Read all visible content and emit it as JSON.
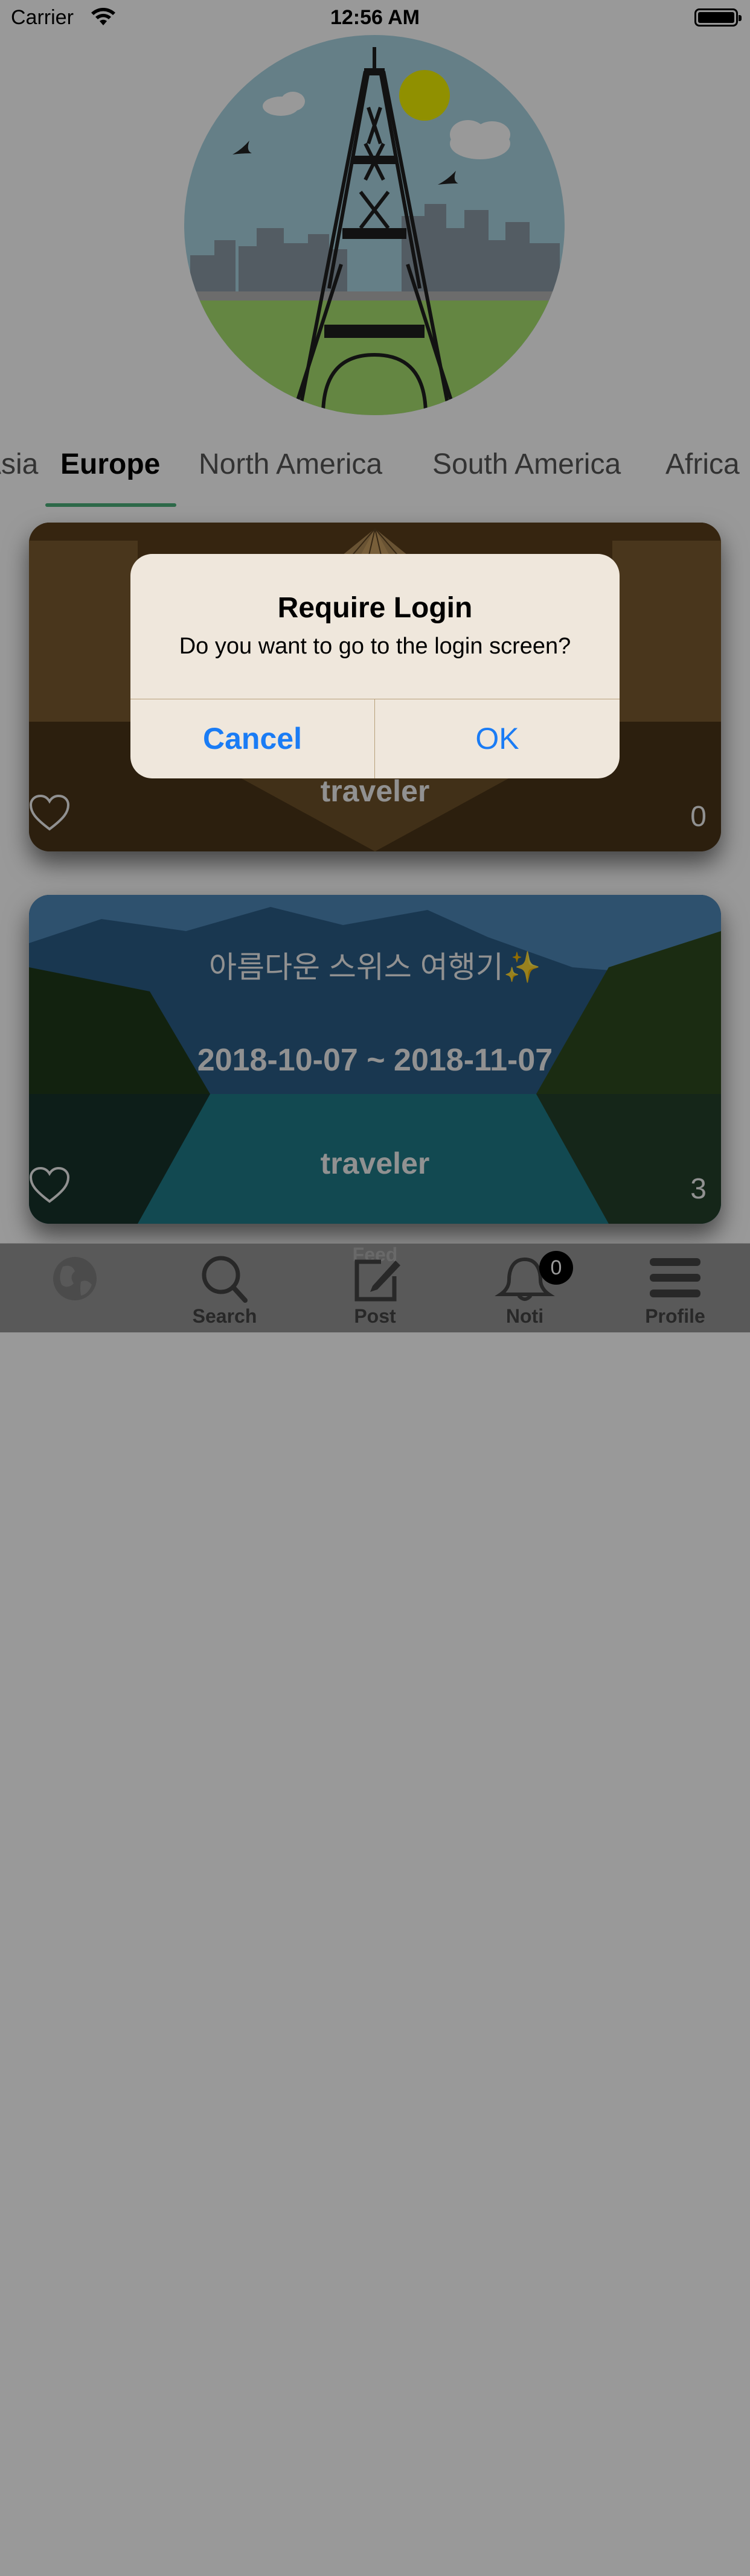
{
  "status_bar": {
    "carrier": "Carrier",
    "time": "12:56 AM"
  },
  "hero": {
    "icon": "eiffel-tower-illustration"
  },
  "continent_tabs": {
    "items": [
      {
        "label": "Asia"
      },
      {
        "label": "Europe"
      },
      {
        "label": "North America"
      },
      {
        "label": "South America"
      },
      {
        "label": "Africa"
      }
    ],
    "selected": "Europe",
    "accent_color": "#4caf7a"
  },
  "cards": [
    {
      "title": "",
      "dates": "",
      "user": "traveler",
      "likes": "0",
      "image": "louvre-pyramid-night"
    },
    {
      "title": "아름다운 스위스 여행기✨",
      "dates": "2018-10-07 ~ 2018-11-07",
      "user": "traveler",
      "likes": "3",
      "image": "swiss-lake-mountains"
    }
  ],
  "tabbar": {
    "items": [
      {
        "label": "Feed",
        "icon": "globe-icon"
      },
      {
        "label": "Search",
        "icon": "search-icon"
      },
      {
        "label": "Post",
        "icon": "compose-icon"
      },
      {
        "label": "Noti",
        "icon": "bell-icon",
        "badge": "0"
      },
      {
        "label": "Profile",
        "icon": "menu-icon"
      }
    ]
  },
  "alert": {
    "title": "Require Login",
    "message": "Do you want to go to the login screen?",
    "cancel_label": "Cancel",
    "ok_label": "OK",
    "button_color": "#1a7cf5"
  }
}
